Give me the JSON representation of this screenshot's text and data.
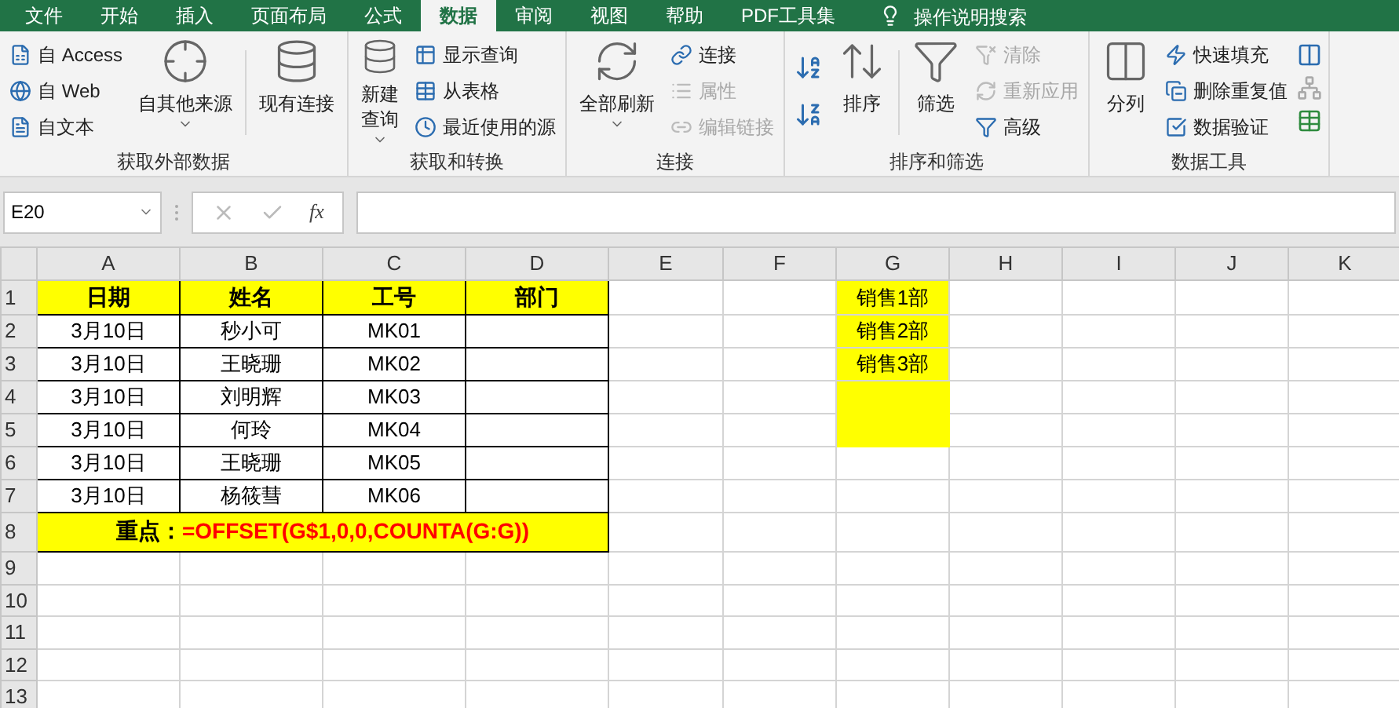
{
  "tabs": [
    {
      "label": "文件",
      "selected": false
    },
    {
      "label": "开始",
      "selected": false
    },
    {
      "label": "插入",
      "selected": false
    },
    {
      "label": "页面布局",
      "selected": false
    },
    {
      "label": "公式",
      "selected": false
    },
    {
      "label": "数据",
      "selected": true
    },
    {
      "label": "审阅",
      "selected": false
    },
    {
      "label": "视图",
      "selected": false
    },
    {
      "label": "帮助",
      "selected": false
    },
    {
      "label": "PDF工具集",
      "selected": false
    }
  ],
  "tell_me": {
    "placeholder": "操作说明搜索"
  },
  "ribbon_groups": [
    {
      "label": "获取外部数据",
      "columns": [
        {
          "kind": "small",
          "items": [
            {
              "label": "自 Access",
              "disabled": false
            },
            {
              "label": "自 Web",
              "disabled": false
            },
            {
              "label": "自文本",
              "disabled": false
            }
          ]
        },
        {
          "kind": "large",
          "lines": [
            "自其他来源"
          ],
          "dropdown": true
        },
        {
          "kind": "separator"
        },
        {
          "kind": "large",
          "lines": [
            "现有连接"
          ],
          "dropdown": false
        }
      ]
    },
    {
      "label": "获取和转换",
      "columns": [
        {
          "kind": "large",
          "lines": [
            "新建",
            "查询"
          ],
          "dropdown": true
        },
        {
          "kind": "small",
          "items": [
            {
              "label": "显示查询",
              "disabled": false
            },
            {
              "label": "从表格",
              "disabled": false
            },
            {
              "label": "最近使用的源",
              "disabled": false
            }
          ]
        }
      ]
    },
    {
      "label": "连接",
      "columns": [
        {
          "kind": "large",
          "lines": [
            "全部刷新"
          ],
          "dropdown": true
        },
        {
          "kind": "small",
          "items": [
            {
              "label": "连接",
              "disabled": false
            },
            {
              "label": "属性",
              "disabled": true
            },
            {
              "label": "编辑链接",
              "disabled": true
            }
          ]
        }
      ]
    },
    {
      "label": "排序和筛选",
      "columns": [
        {
          "kind": "sort"
        },
        {
          "kind": "large",
          "lines": [
            "排序"
          ],
          "dropdown": false
        },
        {
          "kind": "separator"
        },
        {
          "kind": "large",
          "lines": [
            "筛选"
          ],
          "dropdown": false
        },
        {
          "kind": "small",
          "items": [
            {
              "label": "清除",
              "disabled": true
            },
            {
              "label": "重新应用",
              "disabled": true
            },
            {
              "label": "高级",
              "disabled": false
            }
          ]
        }
      ]
    },
    {
      "label": "数据工具",
      "columns": [
        {
          "kind": "large",
          "lines": [
            "分列"
          ],
          "dropdown": false
        },
        {
          "kind": "small",
          "items": [
            {
              "label": "快速填充",
              "disabled": false
            },
            {
              "label": "删除重复值",
              "disabled": false
            },
            {
              "label": "数据验证",
              "disabled": false
            }
          ]
        },
        {
          "kind": "cut"
        }
      ]
    }
  ],
  "name_box": {
    "value": "E20"
  },
  "formula_bar": {
    "function_button": "fx",
    "cancel_disabled": true,
    "enter_disabled": true
  },
  "column_headers": [
    "A",
    "B",
    "C",
    "D",
    "E",
    "F",
    "G",
    "H",
    "I",
    "J",
    "K"
  ],
  "rows": [
    {
      "number": "1",
      "kind": "header",
      "cells": [
        "日期",
        "姓名",
        "工号",
        "部门"
      ],
      "g": {
        "text": "销售1部",
        "highlighted": true
      }
    },
    {
      "number": "2",
      "kind": "data",
      "cells": [
        "3月10日",
        "秒小可",
        "MK01",
        ""
      ],
      "g": {
        "text": "销售2部",
        "highlighted": true
      }
    },
    {
      "number": "3",
      "kind": "data",
      "cells": [
        "3月10日",
        "王晓珊",
        "MK02",
        ""
      ],
      "g": {
        "text": "销售3部",
        "highlighted": true
      }
    },
    {
      "number": "4",
      "kind": "data",
      "cells": [
        "3月10日",
        "刘明辉",
        "MK03",
        ""
      ],
      "g": {
        "highlighted": true
      }
    },
    {
      "number": "5",
      "kind": "data",
      "cells": [
        "3月10日",
        "何玲",
        "MK04",
        ""
      ],
      "g": {
        "highlighted": true
      }
    },
    {
      "number": "6",
      "kind": "data",
      "cells": [
        "3月10日",
        "王晓珊",
        "MK05",
        ""
      ],
      "g": {
        "highlighted": false
      }
    },
    {
      "number": "7",
      "kind": "data",
      "cells": [
        "3月10日",
        "杨筱彗",
        "MK06",
        ""
      ],
      "g": {
        "highlighted": false
      }
    },
    {
      "number": "8",
      "kind": "note",
      "label": "重点：",
      "formula": "=OFFSET(G$1,0,0,COUNTA(G:G))",
      "g": {
        "highlighted": false
      }
    },
    {
      "number": "9",
      "kind": "empty",
      "g": {
        "highlighted": false
      }
    },
    {
      "number": "10",
      "kind": "empty",
      "g": {
        "highlighted": false
      }
    },
    {
      "number": "11",
      "kind": "empty",
      "g": {
        "highlighted": false
      }
    },
    {
      "number": "12",
      "kind": "empty",
      "g": {
        "highlighted": false
      }
    },
    {
      "number": "13",
      "kind": "empty",
      "g": {
        "highlighted": false
      }
    }
  ]
}
